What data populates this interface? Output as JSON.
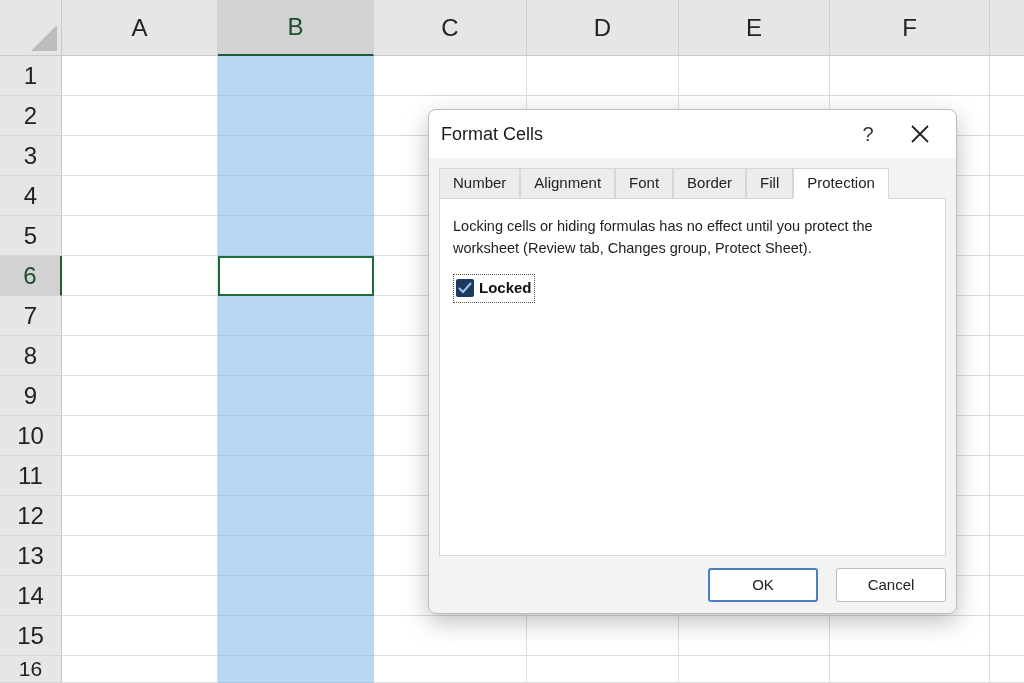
{
  "sheet": {
    "columns": [
      {
        "label": "A",
        "selected": false
      },
      {
        "label": "B",
        "selected": true
      },
      {
        "label": "C",
        "selected": false
      },
      {
        "label": "D",
        "selected": false
      },
      {
        "label": "E",
        "selected": false
      },
      {
        "label": "F",
        "selected": false
      }
    ],
    "rows": [
      {
        "label": "1",
        "selected": false
      },
      {
        "label": "2",
        "selected": false
      },
      {
        "label": "3",
        "selected": false
      },
      {
        "label": "4",
        "selected": false
      },
      {
        "label": "5",
        "selected": false
      },
      {
        "label": "6",
        "selected": true
      },
      {
        "label": "7",
        "selected": false
      },
      {
        "label": "8",
        "selected": false
      },
      {
        "label": "9",
        "selected": false
      },
      {
        "label": "10",
        "selected": false
      },
      {
        "label": "11",
        "selected": false
      },
      {
        "label": "12",
        "selected": false
      },
      {
        "label": "13",
        "selected": false
      },
      {
        "label": "14",
        "selected": false
      },
      {
        "label": "15",
        "selected": false
      },
      {
        "label": "16",
        "selected": false
      }
    ]
  },
  "dialog": {
    "title": "Format Cells",
    "help": "?",
    "tabs": [
      {
        "label": "Number",
        "selected": false
      },
      {
        "label": "Alignment",
        "selected": false
      },
      {
        "label": "Font",
        "selected": false
      },
      {
        "label": "Border",
        "selected": false
      },
      {
        "label": "Fill",
        "selected": false
      },
      {
        "label": "Protection",
        "selected": true
      }
    ],
    "description": "Locking cells or hiding formulas has no effect until you protect the worksheet (Review tab, Changes group, Protect Sheet).",
    "checkbox": {
      "label": "Locked",
      "checked": true
    },
    "buttons": [
      {
        "label": "OK",
        "kind": "default"
      },
      {
        "label": "Cancel",
        "kind": "normal"
      }
    ]
  }
}
